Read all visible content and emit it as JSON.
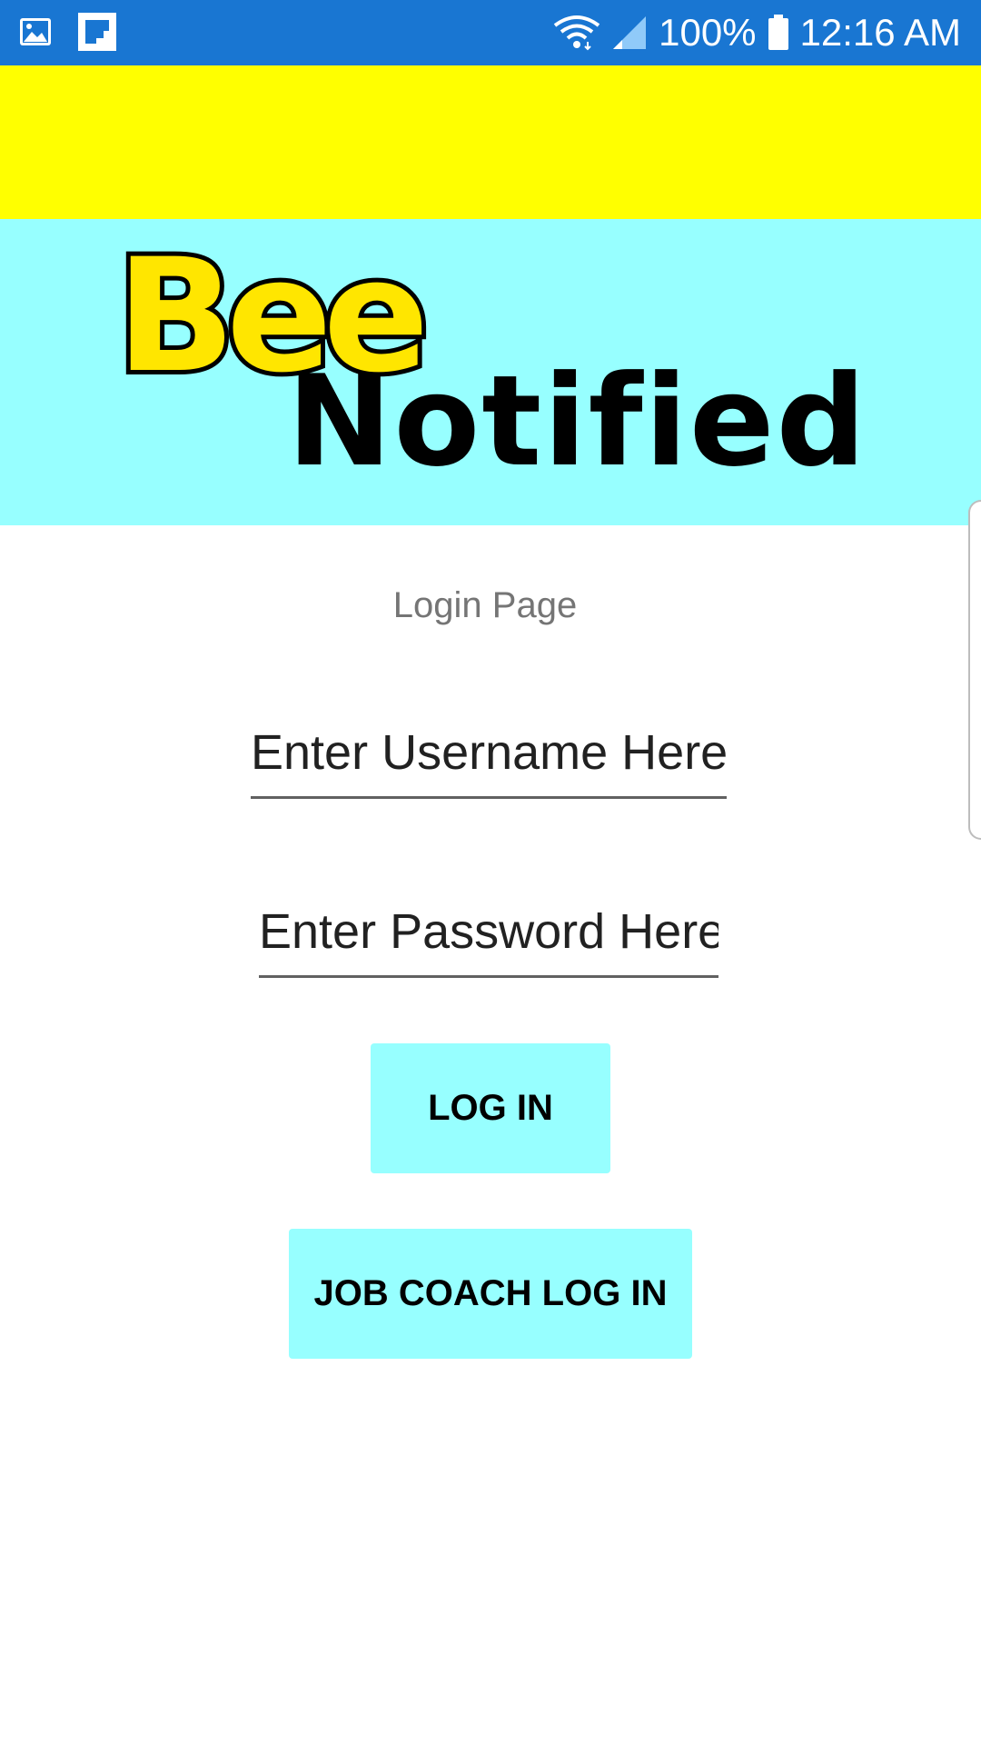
{
  "status_bar": {
    "icons": [
      "image-icon",
      "flipboard-icon",
      "wifi-icon",
      "signal-icon",
      "battery-icon"
    ],
    "battery_text": "100%",
    "time": "12:16 AM"
  },
  "logo": {
    "line1": "Bee",
    "line2": "Notified"
  },
  "login": {
    "title": "Login Page",
    "username_placeholder": "Enter Username Here",
    "password_placeholder": "Enter Password Here",
    "login_button": "LOG IN",
    "job_coach_button": "JOB COACH LOG IN"
  },
  "colors": {
    "status_bar": "#1976d2",
    "toolbar": "#ffff00",
    "banner": "#97ffff",
    "button": "#97ffff",
    "logo_bee": "#ffe600"
  }
}
